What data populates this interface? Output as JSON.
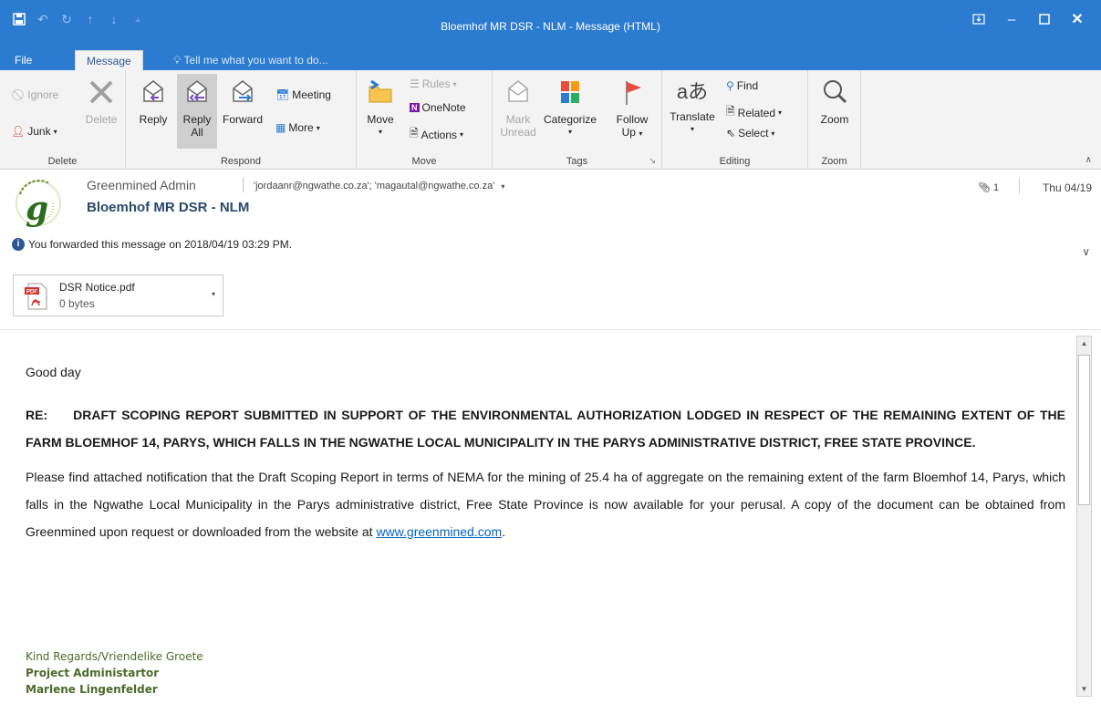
{
  "window": {
    "title": "Bloemhof MR DSR - NLM - Message (HTML)"
  },
  "tabs": [
    {
      "label": "File"
    },
    {
      "label": "Message"
    }
  ],
  "tell_me": "Tell me what you want to do...",
  "ribbon": {
    "delete_group": {
      "label": "Delete",
      "ignore": "Ignore",
      "junk": "Junk",
      "delete": "Delete"
    },
    "respond_group": {
      "label": "Respond",
      "reply": "Reply",
      "reply_all_1": "Reply",
      "reply_all_2": "All",
      "forward": "Forward",
      "meeting": "Meeting",
      "more": "More"
    },
    "move_group": {
      "label": "Move",
      "move": "Move",
      "rules": "Rules",
      "onenote": "OneNote",
      "actions": "Actions"
    },
    "tags_group": {
      "label": "Tags",
      "mark_1": "Mark",
      "mark_2": "Unread",
      "categorize": "Categorize",
      "follow_1": "Follow",
      "follow_2": "Up"
    },
    "editing_group": {
      "label": "Editing",
      "translate": "Translate",
      "find": "Find",
      "related": "Related",
      "select": "Select"
    },
    "zoom_group": {
      "label": "Zoom",
      "zoom": "Zoom"
    }
  },
  "message": {
    "sender": "Greenmined Admin",
    "recipients": "'jordaanr@ngwathe.co.za'; 'magautal@ngwathe.co.za'",
    "subject": "Bloemhof MR DSR - NLM",
    "forward_notice": "You forwarded this message on 2018/04/19 03:29 PM.",
    "attachment_count": "1",
    "date": "Thu 04/19"
  },
  "attachment": {
    "name": "DSR Notice.pdf",
    "size": "0 bytes",
    "type_label": "PDF"
  },
  "body": {
    "greeting": "Good day",
    "re_label": "RE:",
    "re_text": "DRAFT SCOPING REPORT SUBMITTED IN SUPPORT OF THE ENVIRONMENTAL AUTHORIZATION LODGED IN RESPECT OF THE REMAINING EXTENT OF THE FARM BLOEMHOF 14, PARYS, WHICH FALLS IN THE NGWATHE LOCAL MUNICIPALITY IN THE PARYS ADMINISTRATIVE DISTRICT, FREE STATE PROVINCE.",
    "paragraph": "Please find attached notification that the Draft Scoping Report in terms of NEMA for the mining of 25.4 ha of aggregate on the remaining extent of the farm Bloemhof 14, Parys, which falls in the Ngwathe Local Municipality in the Parys administrative district, Free State Province is now available for your perusal. A copy of the document can be obtained from Greenmined upon request or downloaded from the website at ",
    "link": "www.greenmined.com",
    "period": "."
  },
  "signature": {
    "regards": "Kind Regards/Vriendelike Groete",
    "role": "Project Administartor",
    "name": "Marlene Lingenfelder"
  },
  "colors": {
    "titlebar": "#2b7bd0",
    "ribbon": "#f3f3f3",
    "link": "#0563c1",
    "signature": "#4b6b2a"
  }
}
